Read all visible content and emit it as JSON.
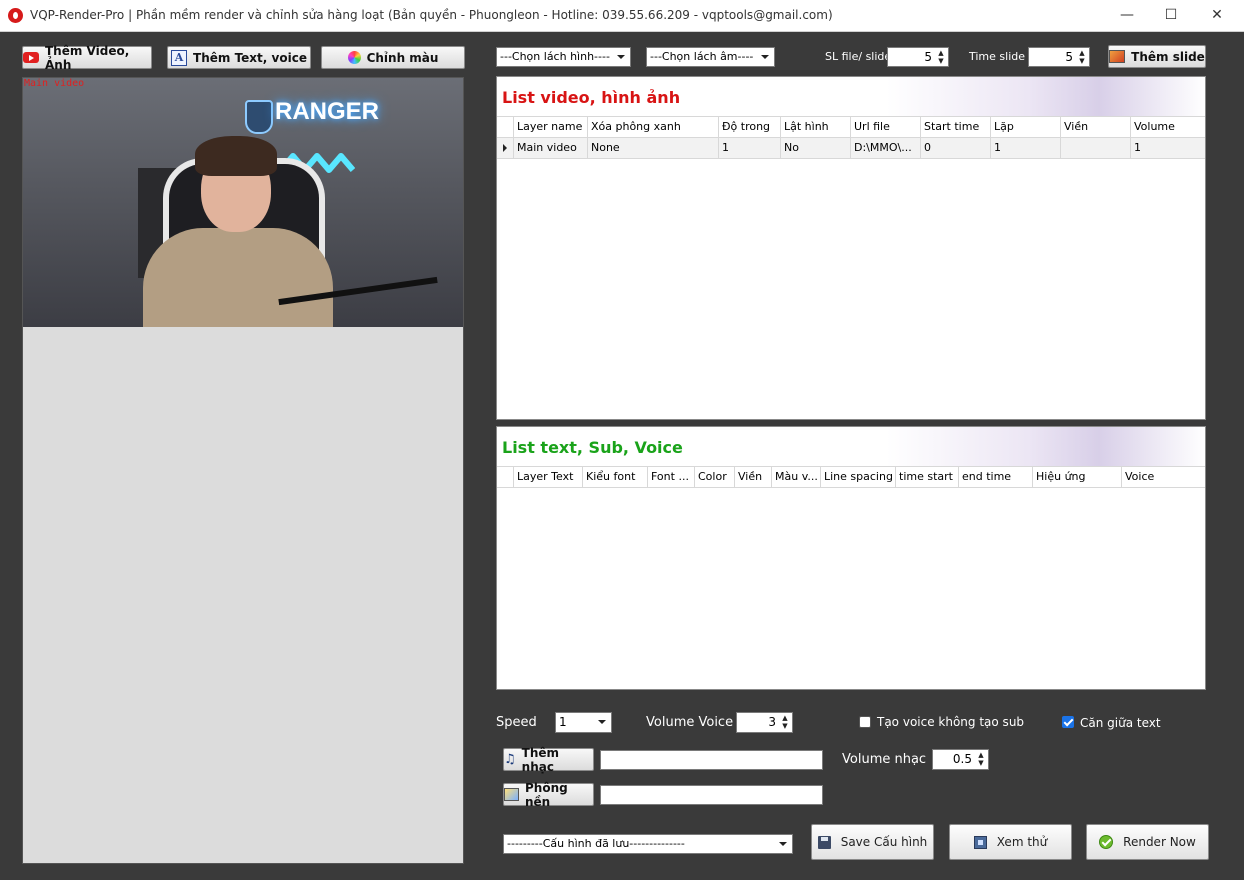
{
  "window": {
    "title": "VQP-Render-Pro | Phần mềm render và chỉnh sửa hàng loạt (Bản quyền - Phuongleon - Hotline: 039.55.66.209 - vqptools@gmail.com)",
    "minimize": "—",
    "maximize": "☐",
    "close": "✕"
  },
  "toolbar": {
    "add_video_label": "Thêm Video, Ảnh",
    "add_text_label": "Thêm Text, voice",
    "color_label": "Chỉnh màu",
    "transition_image": "---Chọn lách hình----",
    "transition_audio": "---Chọn lách âm----",
    "files_per_slide_label": "SL file/ slide",
    "files_per_slide_value": "5",
    "time_slide_label": "Time slide",
    "time_slide_value": "5",
    "add_slide_label": "Thêm slide"
  },
  "preview": {
    "overlay_label": "Main video",
    "sign_text": "RANGER"
  },
  "video_list": {
    "title": "List video, hình ảnh",
    "title_color": "#d81414",
    "columns": [
      "Layer name",
      "Xóa phông xanh",
      "Độ trong",
      "Lật hình",
      "Url file",
      "Start time",
      "Lặp",
      "Viền",
      "Volume"
    ],
    "rows": [
      [
        "Main video",
        "None",
        "1",
        "No",
        "D:\\MMO\\...",
        "0",
        "1",
        "",
        "1"
      ]
    ]
  },
  "text_list": {
    "title": "List text, Sub, Voice",
    "title_color": "#1aa31a",
    "columns": [
      "Layer Text",
      "Kiểu font",
      "Font ...",
      "Color",
      "Viền",
      "Màu v...",
      "Line spacing",
      "time start",
      "end time",
      "Hiệu ứng",
      "Voice"
    ]
  },
  "settings": {
    "speed_label": "Speed",
    "speed_value": "1",
    "volume_voice_label": "Volume Voice",
    "volume_voice_value": "3",
    "voice_no_sub_label": "Tạo voice không tạo sub",
    "voice_no_sub_checked": false,
    "center_text_label": "Căn giữa text",
    "center_text_checked": true,
    "add_music_label": "Thêm nhạc",
    "music_path": "",
    "volume_music_label": "Volume nhạc",
    "volume_music_value": "0.5",
    "background_label": "Phông nền",
    "background_path": "",
    "saved_config": "---------Cấu hình đã lưu--------------",
    "save_config_label": "Save Cấu hình",
    "preview_label": "Xem thử",
    "render_label": "Render Now"
  }
}
